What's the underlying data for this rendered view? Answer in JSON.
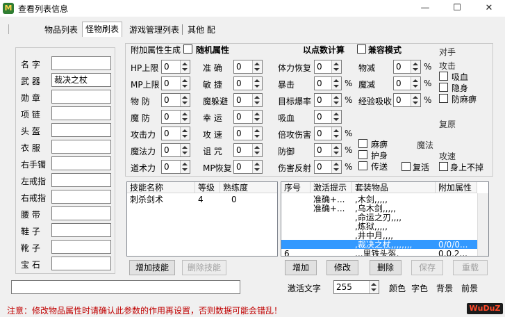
{
  "window": {
    "title": "查看列表信息",
    "icon": "app-icon",
    "controls": {
      "minimize": "—",
      "maximize": "☐",
      "close": "✕"
    }
  },
  "tabs": [
    {
      "label": "物品列表"
    },
    {
      "label": "怪物刷表"
    },
    {
      "label": "游戏管理列表"
    },
    {
      "label": "其他 配"
    }
  ],
  "left": {
    "fields": [
      {
        "label": "名  字",
        "value": ""
      },
      {
        "label": "武  器",
        "value": "裁决之杖"
      },
      {
        "label": "勋  章",
        "value": ""
      },
      {
        "label": "项  链",
        "value": ""
      },
      {
        "label": "头  盔",
        "value": ""
      },
      {
        "label": "衣  服",
        "value": ""
      },
      {
        "label": "右手镯",
        "value": ""
      },
      {
        "label": "左戒指",
        "value": ""
      },
      {
        "label": "右戒指",
        "value": ""
      },
      {
        "label": "腰  带",
        "value": ""
      },
      {
        "label": "鞋  子",
        "value": ""
      },
      {
        "label": "靴  子",
        "value": ""
      },
      {
        "label": "宝  石",
        "value": ""
      }
    ]
  },
  "attr": {
    "header": {
      "label": "附加属性生成",
      "random": "随机属性",
      "count_label": "以点数计算",
      "compat": "兼容模式"
    },
    "row1": [
      {
        "label": "HP上限",
        "value": "0"
      },
      {
        "label": "MP上限",
        "value": "0"
      },
      {
        "label": "物  防",
        "value": "0"
      },
      {
        "label": "魔  防",
        "value": "0"
      },
      {
        "label": "攻击力",
        "value": "0"
      },
      {
        "label": "魔法力",
        "value": "0"
      },
      {
        "label": "道术力",
        "value": "0"
      }
    ],
    "row2": [
      {
        "label": "准  确",
        "value": "0"
      },
      {
        "label": "敏  捷",
        "value": "0"
      },
      {
        "label": "魔躲避",
        "value": "0"
      },
      {
        "label": "幸  运",
        "value": "0"
      },
      {
        "label": "攻  速",
        "value": "0"
      },
      {
        "label": "诅  咒",
        "value": "0"
      },
      {
        "label": "MP恢复",
        "value": "0"
      }
    ],
    "row3": [
      {
        "label": "体力恢复",
        "value": "0"
      },
      {
        "label": "暴击",
        "value": "0",
        "unit": "%"
      },
      {
        "label": "目标爆率",
        "value": "0",
        "unit": "%"
      },
      {
        "label": "吸血",
        "value": "0"
      },
      {
        "label": "倍攻伤害",
        "value": "0",
        "unit": "%"
      },
      {
        "label": "防御",
        "value": "0",
        "unit": "%"
      },
      {
        "label": "伤害反射",
        "value": "0",
        "unit": "%"
      }
    ],
    "row4": [
      {
        "label": "物减",
        "value": "0",
        "unit": "%"
      },
      {
        "label": "魔减",
        "value": "0",
        "unit": "%"
      },
      {
        "label": "经验吸收",
        "value": "0",
        "unit": "%"
      }
    ],
    "checks_mid": [
      "麻痹",
      "护身",
      "传送"
    ],
    "checks_right": [
      "吸血",
      "隐身",
      "防麻痹"
    ],
    "checks_bottom": [
      "复活",
      "身上不掉"
    ],
    "extra_labels": [
      "对手",
      "攻击",
      "复原",
      "魔法",
      "攻速"
    ]
  },
  "skills": {
    "columns": [
      "技能名称",
      "等级",
      "熟练度"
    ],
    "rows": [
      {
        "name": "刺杀剑术",
        "level": "4",
        "exp": "0"
      }
    ],
    "add_button": "增加技能",
    "del_button": "删除技能"
  },
  "items": {
    "columns": [
      "序号",
      "激活提示",
      "套装物品",
      "附加属性"
    ],
    "rows": [
      {
        "no": "",
        "tip": "准确+...",
        "item": ",木剑,,,,,",
        "attr": ""
      },
      {
        "no": "",
        "tip": "准确+...",
        "item": ",乌木剑,,,,,",
        "attr": ""
      },
      {
        "no": "",
        "tip": "",
        "item": ",命运之刃,,,,",
        "attr": ""
      },
      {
        "no": "",
        "tip": "",
        "item": ",炼狱,,,,,",
        "attr": ""
      },
      {
        "no": "",
        "tip": "",
        "item": ",井中月,,,,",
        "attr": ""
      },
      {
        "no": "",
        "tip": "",
        "item": ",裁决之杖,,,,,,,,",
        "attr": "0/0/0..."
      },
      {
        "no": "6",
        "tip": "",
        "item": ",,,里铁头盔,",
        "attr": "0,0,2..."
      }
    ],
    "selected_index": 5,
    "buttons": {
      "add": "增加",
      "edit": "修改",
      "del": "删除",
      "save": "保存",
      "reload": "重载"
    }
  },
  "bottom": {
    "text_input": "",
    "activate_label": "激活文字",
    "activate_value": "255",
    "extra": [
      "颜色",
      "字色",
      "背景",
      "前景"
    ]
  },
  "status": {
    "message": "注意：修改物品属性时请确认此参数的作用再设置，否则数据可能会错乱！",
    "logo": "WuDuZ"
  },
  "colors": {
    "selection": "#3399ff",
    "status_text": "#c00000",
    "window_bg": "#f0f0f0"
  }
}
